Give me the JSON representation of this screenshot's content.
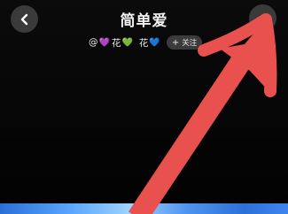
{
  "header": {
    "title": "简单爱",
    "back_icon": "chevron-left-icon",
    "more_icon": "more-horizontal-icon"
  },
  "user": {
    "prefix": "@",
    "name_part1": "花",
    "name_part2": "花",
    "heart1": "💜",
    "heart2": "💚",
    "heart3": "💙",
    "follow_label": "关注",
    "follow_plus": "+"
  },
  "annotation": {
    "arrow_color": "#e8514e",
    "arrow_target": "more-button"
  },
  "colors": {
    "background": "#050505",
    "button_bg": "#3a3a3a",
    "bottom_strip": "#4f93f0"
  }
}
